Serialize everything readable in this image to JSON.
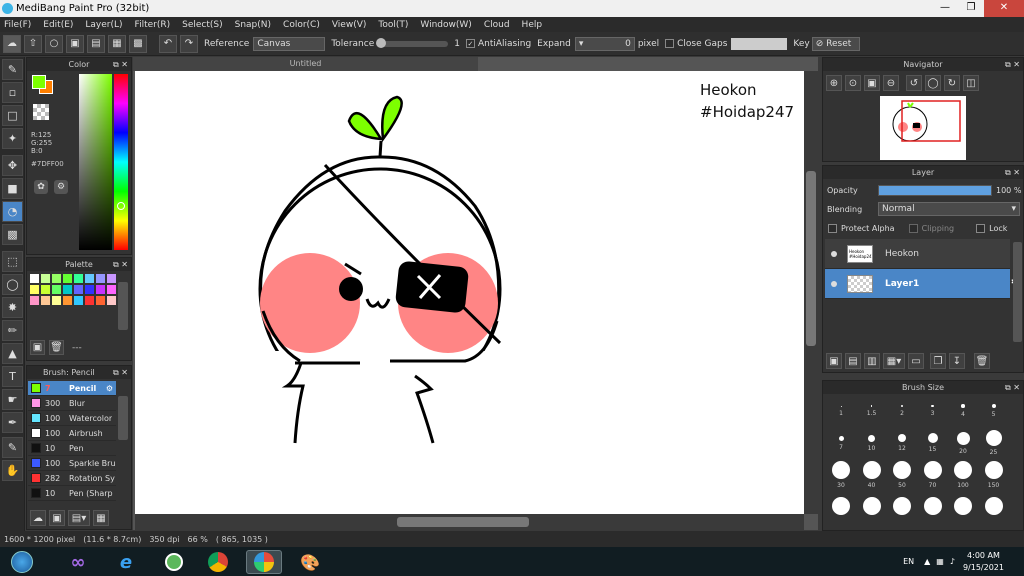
{
  "window": {
    "title": "MediBang Paint Pro (32bit)"
  },
  "menu": [
    "File(F)",
    "Edit(E)",
    "Layer(L)",
    "Filter(R)",
    "Select(S)",
    "Snap(N)",
    "Color(C)",
    "View(V)",
    "Tool(T)",
    "Window(W)",
    "Cloud",
    "Help"
  ],
  "toolbar": {
    "reference_label": "Reference",
    "reference_value": "Canvas",
    "tolerance_label": "Tolerance",
    "tolerance_value": "1",
    "antialias_label": "AntiAliasing",
    "expand_label": "Expand",
    "expand_value": "0",
    "expand_unit": "pixel",
    "close_gaps_label": "Close Gaps",
    "key_label": "Key",
    "reset_label": "Reset"
  },
  "color_panel": {
    "title": "Color",
    "rgb_r": "R:125",
    "rgb_g": "G:255",
    "rgb_b": "B:0",
    "hex": "#7DFF00",
    "primary_color": "#7DFF00",
    "secondary_color": "#FF7F00"
  },
  "palette_panel": {
    "title": "Palette",
    "dash": "---",
    "swatches": [
      "#ffffff",
      "#c8ff96",
      "#96ff64",
      "#64ff32",
      "#32ff96",
      "#64c8ff",
      "#9696ff",
      "#c896ff",
      "#ffff64",
      "#c8ff32",
      "#64ff64",
      "#00c8c8",
      "#6464ff",
      "#3232ff",
      "#c832ff",
      "#ff64ff",
      "#ff96c8",
      "#ffc896",
      "#ffff96",
      "#ff9632",
      "#32c8ff",
      "#ff3232",
      "#ff6432",
      "#ffc8c8"
    ]
  },
  "brush_panel": {
    "title": "Brush: Pencil",
    "items": [
      {
        "size": "7",
        "name": "Pencil",
        "color": "#7DFF00"
      },
      {
        "size": "300",
        "name": "Blur",
        "color": "#ff96e6"
      },
      {
        "size": "100",
        "name": "Watercolor",
        "color": "#64e6ff"
      },
      {
        "size": "100",
        "name": "Airbrush",
        "color": "#ffffff"
      },
      {
        "size": "10",
        "name": "Pen",
        "color": "#111111"
      },
      {
        "size": "100",
        "name": "Sparkle Bru",
        "color": "#3c5aff"
      },
      {
        "size": "282",
        "name": "Rotation Sy",
        "color": "#ff3232"
      },
      {
        "size": "10",
        "name": "Pen (Sharp",
        "color": "#111111"
      }
    ]
  },
  "canvas": {
    "tab_title": "Untitled",
    "watermark_line1": "Heokon",
    "watermark_line2": "#Hoidap247"
  },
  "navigator_panel": {
    "title": "Navigator"
  },
  "layer_panel": {
    "title": "Layer",
    "opacity_label": "Opacity",
    "opacity_value": "100 %",
    "opacity_fraction": 1.0,
    "blending_label": "Blending",
    "blending_value": "Normal",
    "protect_alpha_label": "Protect Alpha",
    "clipping_label": "Clipping",
    "lock_label": "Lock",
    "layers": [
      {
        "name": "Heokon",
        "thumb_text": "Heokon #Hoidap247"
      },
      {
        "name": "Layer1"
      }
    ]
  },
  "brush_size_panel": {
    "title": "Brush Size",
    "sizes": [
      "1",
      "1.5",
      "2",
      "3",
      "4",
      "5",
      "7",
      "10",
      "12",
      "15",
      "20",
      "25",
      "30",
      "40",
      "50",
      "70",
      "100",
      "150"
    ]
  },
  "status": {
    "dimensions": "1600 * 1200 pixel",
    "physical": "(11.6 * 8.7cm)",
    "dpi": "350 dpi",
    "zoom": "66 %",
    "coords": "( 865, 1035 )"
  },
  "taskbar": {
    "lang": "EN",
    "time": "4:00 AM",
    "date": "9/15/2021"
  }
}
